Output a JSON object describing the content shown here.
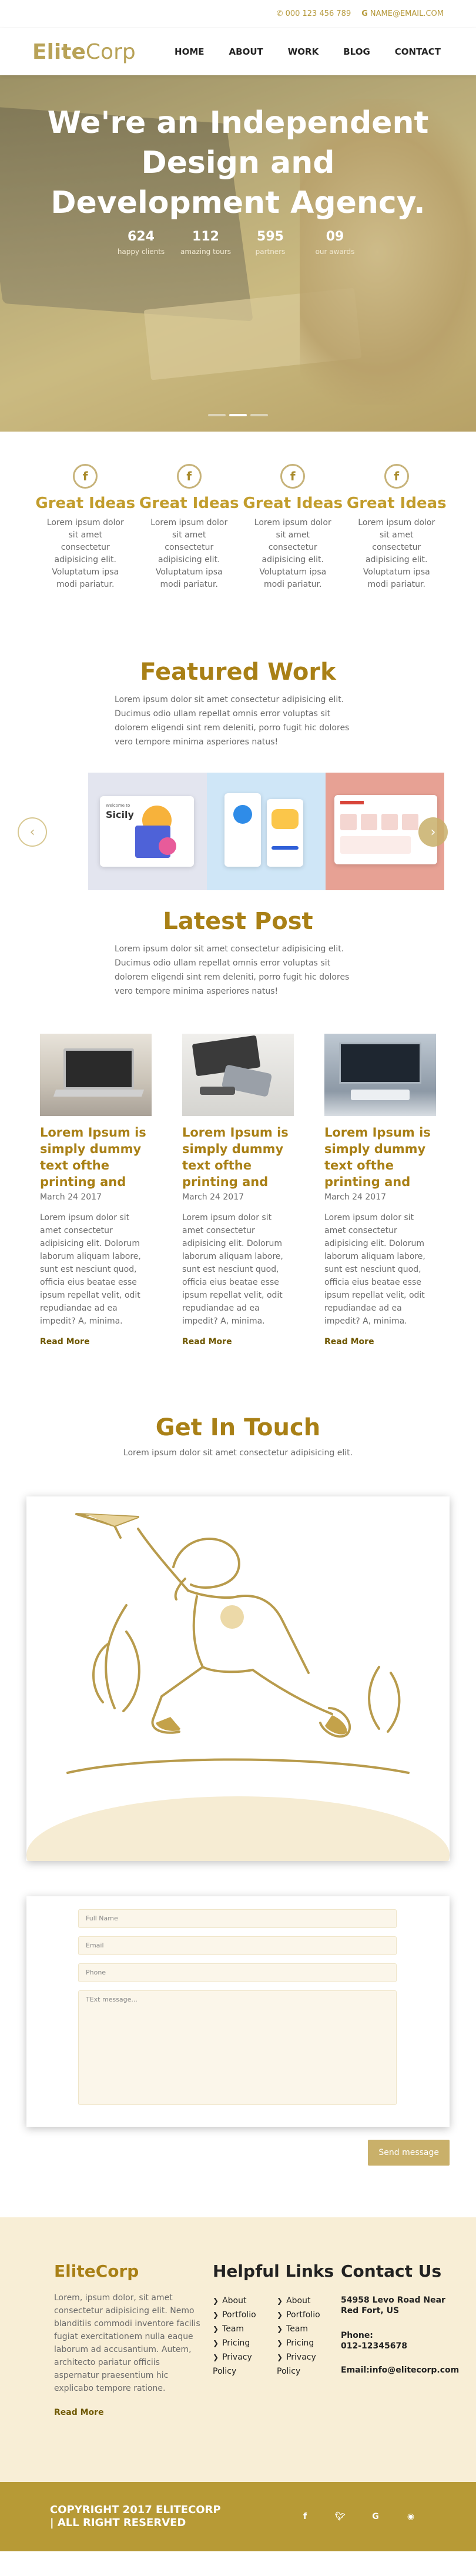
{
  "topbar": {
    "phone": "000 123 456 789",
    "email": "NAME@EMAIL.COM"
  },
  "nav": {
    "logo_bold": "Elite",
    "logo_light": "Corp",
    "items": [
      "HOME",
      "ABOUT",
      "WORK",
      "BLOG",
      "CONTACT"
    ]
  },
  "hero": {
    "title": "We're an Independent Design and Development Agency.",
    "stats": [
      {
        "value": "624",
        "label": "happy clients"
      },
      {
        "value": "112",
        "label": "amazing tours"
      },
      {
        "value": "595",
        "label": "partners"
      },
      {
        "value": "09",
        "label": "our awards"
      }
    ],
    "active_slide": 1,
    "slide_count": 3
  },
  "features": [
    {
      "icon": "facebook-icon",
      "title": "Great Ideas",
      "text": "Lorem ipsum dolor sit amet consectetur adipisicing elit. Voluptatum ipsa modi pariatur."
    },
    {
      "icon": "facebook-icon",
      "title": "Great Ideas",
      "text": "Lorem ipsum dolor sit amet consectetur adipisicing elit. Voluptatum ipsa modi pariatur."
    },
    {
      "icon": "facebook-icon",
      "title": "Great Ideas",
      "text": "Lorem ipsum dolor sit amet consectetur adipisicing elit. Voluptatum ipsa modi pariatur."
    },
    {
      "icon": "facebook-icon",
      "title": "Great Ideas",
      "text": "Lorem ipsum dolor sit amet consectetur adipisicing elit. Voluptatum ipsa modi pariatur."
    }
  ],
  "featured": {
    "title": "Featured Work",
    "text": "Lorem ipsum dolor sit amet consectetur adipisicing elit. Ducimus odio ullam repellat omnis error voluptas sit dolorem eligendi sint rem deleniti, porro fugit hic dolores vero tempore minima asperiores natus!",
    "slide1_caption_small": "Welcome to",
    "slide1_caption": "Sicily"
  },
  "latest": {
    "title": "Latest Post",
    "text": "Lorem ipsum dolor sit amet consectetur adipisicing elit. Ducimus odio ullam repellat omnis error voluptas sit dolorem eligendi sint rem deleniti, porro fugit hic dolores vero tempore minima asperiores natus!",
    "posts": [
      {
        "title": "Lorem Ipsum is simply dummy text ofthe printing and",
        "date": "March 24 2017",
        "body": "Lorem ipsum dolor sit amet consectetur adipisicing elit. Dolorum laborum aliquam labore, sunt est nesciunt quod, officia eius beatae esse ipsum repellat velit, odit repudiandae ad ea impedit? A, minima.",
        "more": "Read More"
      },
      {
        "title": "Lorem Ipsum is simply dummy text ofthe printing and",
        "date": "March 24 2017",
        "body": "Lorem ipsum dolor sit amet consectetur adipisicing elit. Dolorum laborum aliquam labore, sunt est nesciunt quod, officia eius beatae esse ipsum repellat velit, odit repudiandae ad ea impedit? A, minima.",
        "more": "Read More"
      },
      {
        "title": "Lorem Ipsum is simply dummy text ofthe printing and",
        "date": "March 24 2017",
        "body": "Lorem ipsum dolor sit amet consectetur adipisicing elit. Dolorum laborum aliquam labore, sunt est nesciunt quod, officia eius beatae esse ipsum repellat velit, odit repudiandae ad ea impedit? A, minima.",
        "more": "Read More"
      }
    ]
  },
  "contact": {
    "title": "Get In Touch",
    "sub": "Lorem ipsum dolor sit amet consectetur adipisicing elit.",
    "fields": {
      "name": "Full Name",
      "email": "Email",
      "phone": "Phone",
      "message": "TExt message..."
    },
    "send": "Send message"
  },
  "footer": {
    "brand": "EliteCorp",
    "about": "Lorem, ipsum dolor, sit amet consectetur adipisicing elit. Nemo blanditiis commodi inventore facilis fugiat exercitationem nulla eaque laborum ad accusantium. Autem, architecto pariatur officiis aspernatur praesentium hic explicabo tempore ratione.",
    "more": "Read More",
    "links_title": "Helpful Links",
    "links_col1": [
      "About",
      "Portfolio",
      "Team",
      "Pricing",
      "Privacy Policy"
    ],
    "links_col2": [
      "About",
      "Portfolio",
      "Team",
      "Pricing",
      "Privacy Policy"
    ],
    "contact_title": "Contact Us",
    "address": "54958 Levo Road Near Red Fort, US",
    "phone_label": "Phone:",
    "phone": "012-12345678",
    "email_label": "Email:",
    "email": "info@elitecorp.com"
  },
  "bottom": {
    "copyright": "COPYRIGHT 2017 ELITECORP | ALL RIGHT RESERVED",
    "socials": [
      "facebook-icon",
      "twitter-icon",
      "google-icon",
      "github-icon"
    ]
  },
  "colors": {
    "accent": "#b79a36",
    "heading": "#a98016",
    "footer_bg": "#f8eed6"
  }
}
